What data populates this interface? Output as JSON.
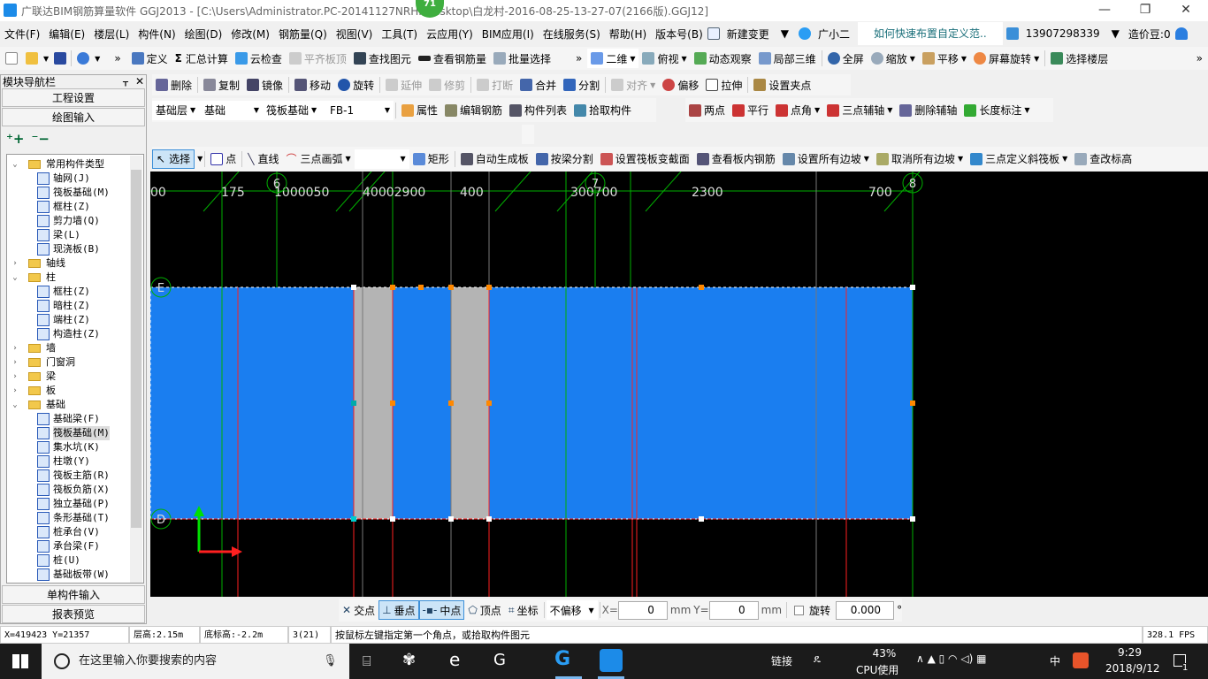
{
  "title": {
    "text": "广联达BIM钢筋算量软件 GGJ2013 - [C:\\Users\\Administrator.PC-20141127NRHI\\Desktop\\白龙村-2016-08-25-13-27-07(2166版).GGJ12]",
    "badge": "71"
  },
  "menu": [
    "文件(F)",
    "编辑(E)",
    "楼层(L)",
    "构件(N)",
    "绘图(D)",
    "修改(M)",
    "钢筋量(Q)",
    "视图(V)",
    "工具(T)",
    "云应用(Y)",
    "BIM应用(I)",
    "在线服务(S)",
    "帮助(H)",
    "版本号(B)"
  ],
  "menu_extra": {
    "new_change": "新建变更",
    "assistant": "广小二",
    "news": "如何快速布置自定义范..",
    "account": "13907298339",
    "beans": "造价豆:0"
  },
  "toolbar1": [
    "定义",
    "汇总计算",
    "云检查",
    "平齐板顶",
    "查找图元",
    "查看钢筋量",
    "批量选择"
  ],
  "toolbar1b": [
    "二维",
    "俯视",
    "动态观察",
    "局部三维",
    "全屏",
    "缩放",
    "平移",
    "屏幕旋转",
    "选择楼层"
  ],
  "edit_toolbar": [
    "删除",
    "复制",
    "镜像",
    "移动",
    "旋转",
    "延伸",
    "修剪",
    "打断",
    "合并",
    "分割",
    "对齐",
    "偏移",
    "拉伸",
    "设置夹点"
  ],
  "selectors": {
    "floor": "基础层",
    "category": "基础",
    "type": "筏板基础",
    "name": "FB-1"
  },
  "comp_toolbar": [
    "属性",
    "编辑钢筋",
    "构件列表",
    "拾取构件"
  ],
  "axis_toolbar": [
    "两点",
    "平行",
    "点角",
    "三点辅轴",
    "删除辅轴",
    "长度标注"
  ],
  "draw_toolbar": [
    "选择",
    "点",
    "直线",
    "三点画弧",
    "",
    "矩形",
    "自动生成板",
    "按梁分割",
    "设置筏板变截面",
    "查看板内钢筋",
    "设置所有边坡",
    "取消所有边坡",
    "三点定义斜筏板",
    "查改标高"
  ],
  "nav": {
    "title": "模块导航栏",
    "project": "工程设置",
    "drawing": "绘图输入",
    "single": "单构件输入",
    "report": "报表预览"
  },
  "tree": [
    {
      "label": "常用构件类型",
      "level": 0,
      "folder": true,
      "open": true
    },
    {
      "label": "轴网(J)",
      "level": 1
    },
    {
      "label": "筏板基础(M)",
      "level": 1
    },
    {
      "label": "框柱(Z)",
      "level": 1
    },
    {
      "label": "剪力墙(Q)",
      "level": 1
    },
    {
      "label": "梁(L)",
      "level": 1
    },
    {
      "label": "现浇板(B)",
      "level": 1
    },
    {
      "label": "轴线",
      "level": 0,
      "folder": true
    },
    {
      "label": "柱",
      "level": 0,
      "folder": true,
      "open": true
    },
    {
      "label": "框柱(Z)",
      "level": 1
    },
    {
      "label": "暗柱(Z)",
      "level": 1
    },
    {
      "label": "端柱(Z)",
      "level": 1
    },
    {
      "label": "构造柱(Z)",
      "level": 1
    },
    {
      "label": "墙",
      "level": 0,
      "folder": true
    },
    {
      "label": "门窗洞",
      "level": 0,
      "folder": true
    },
    {
      "label": "梁",
      "level": 0,
      "folder": true
    },
    {
      "label": "板",
      "level": 0,
      "folder": true
    },
    {
      "label": "基础",
      "level": 0,
      "folder": true,
      "open": true
    },
    {
      "label": "基础梁(F)",
      "level": 1
    },
    {
      "label": "筏板基础(M)",
      "level": 1,
      "selected": true
    },
    {
      "label": "集水坑(K)",
      "level": 1
    },
    {
      "label": "柱墩(Y)",
      "level": 1
    },
    {
      "label": "筏板主筋(R)",
      "level": 1
    },
    {
      "label": "筏板负筋(X)",
      "level": 1
    },
    {
      "label": "独立基础(P)",
      "level": 1
    },
    {
      "label": "条形基础(T)",
      "level": 1
    },
    {
      "label": "桩承台(V)",
      "level": 1
    },
    {
      "label": "承台梁(F)",
      "level": 1
    },
    {
      "label": "桩(U)",
      "level": 1
    },
    {
      "label": "基础板带(W)",
      "level": 1
    }
  ],
  "canvas": {
    "dims": [
      "00",
      "175",
      "1000050",
      "40002900",
      "400",
      "300700",
      "2300",
      "700"
    ],
    "axes": [
      "6",
      "7",
      "8",
      "E",
      "D"
    ],
    "colors": {
      "slab": "#1a7ef0",
      "gray": "#b4b4b4",
      "grid": "#00c000",
      "red": "#ff2020"
    }
  },
  "snap": {
    "items": [
      "交点",
      "垂点",
      "中点",
      "顶点",
      "坐标"
    ],
    "offset": "不偏移",
    "x_label": "X=",
    "x": "0",
    "y_label": "Y=",
    "y": "0",
    "unit": "mm",
    "rotate": "旋转",
    "angle": "0.000",
    "deg": "°"
  },
  "status": {
    "coords": "X=419423 Y=21357",
    "floor_h": "层高:2.15m",
    "bottom": "底标高:-2.2m",
    "count": "3(21)",
    "hint": "按鼠标左键指定第一个角点，或拾取构件图元",
    "fps": "328.1 FPS"
  },
  "taskbar": {
    "search": "在这里输入你要搜索的内容",
    "link": "链接",
    "cpu_pct": "43%",
    "cpu": "CPU使用",
    "ime": "中",
    "time": "9:29",
    "date": "2018/9/12",
    "notif": "1"
  }
}
